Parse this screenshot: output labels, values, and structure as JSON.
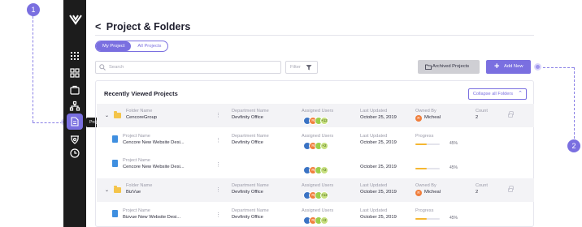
{
  "tooltip": "Project & Folders",
  "markers": [
    "1",
    "2"
  ],
  "header": {
    "back_glyph": "<",
    "title": "Project & Folders"
  },
  "tabs": [
    {
      "label": "My Project",
      "active": true
    },
    {
      "label": "All Projects",
      "active": false
    }
  ],
  "search": {
    "placeholder": "Search"
  },
  "filter": {
    "label": "Filter"
  },
  "buttons": {
    "archived": "Archived Projects",
    "add_new": "Add New",
    "collapse": "Collapse all Folders"
  },
  "panel": {
    "title": "Recently Viewed Projects"
  },
  "column_labels": {
    "folder_name": "Folder Name",
    "project_name": "Project Name",
    "department": "Department Name",
    "assigned": "Assigned Users",
    "updated": "Last Updated",
    "owned": "Owned By",
    "progress": "Progress",
    "count": "Count"
  },
  "avatar_badges": {
    "letter": "R",
    "plus_folder": "+12",
    "plus_project": "+2"
  },
  "rows": [
    {
      "type": "folder",
      "name": "CencoreGroup",
      "department": "Devfinity Office",
      "updated": "October 25, 2019",
      "owner": "Micheal",
      "owner_initial": "R",
      "count": "2"
    },
    {
      "type": "project",
      "name": "Cencore New Website Desi...",
      "department": "Devfinity Office",
      "updated": "October 25, 2019",
      "progress": 0.45,
      "progress_label": "45%"
    },
    {
      "type": "project",
      "name": "Cencore New Website Desi...",
      "department": "",
      "updated": "October 25, 2019",
      "progress": 0.45,
      "progress_label": "45%"
    },
    {
      "type": "folder",
      "name": "BizVue",
      "department": "Devfinity Office",
      "updated": "October 25, 2019",
      "owner": "Micheal",
      "owner_initial": "R",
      "count": "2"
    },
    {
      "type": "project",
      "name": "Bizvue New Website Desi...",
      "department": "Devfinity Office",
      "updated": "October 25, 2019",
      "progress": 0.45,
      "progress_label": "45%"
    }
  ],
  "colors": {
    "accent": "#7a6fe0",
    "sidebar": "#1c1c1c",
    "folder": "#f4c44a",
    "progress": "#f5b731"
  },
  "icons": [
    "logo-icon",
    "grid-icon",
    "dashboard-icon",
    "briefcase-icon",
    "hierarchy-icon",
    "folder-doc-icon",
    "badge-icon",
    "clock-icon",
    "search-icon",
    "filter-icon",
    "archive-folder-icon",
    "plus-icon",
    "chevron-up-icon",
    "chevron-down-icon",
    "folder-icon",
    "document-icon",
    "kebab-icon",
    "lock-icon"
  ]
}
